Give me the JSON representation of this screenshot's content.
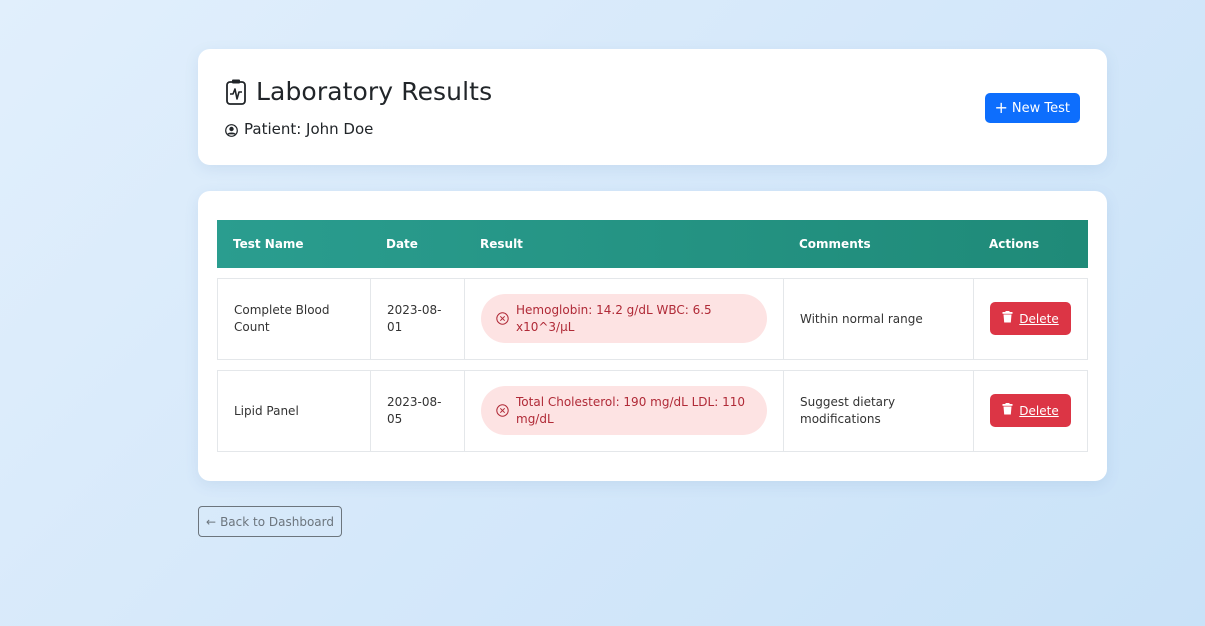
{
  "header": {
    "title": "Laboratory Results",
    "patient_label": "Patient: John Doe",
    "new_test_label": "New Test",
    "title_icon": "clipboard-pulse-icon",
    "patient_icon": "person-circle-icon"
  },
  "table": {
    "columns": [
      "Test Name",
      "Date",
      "Result",
      "Comments",
      "Actions"
    ],
    "rows": [
      {
        "test_name": "Complete Blood Count",
        "date": "2023-08-01",
        "result": "Hemoglobin: 14.2 g/dL WBC: 6.5 x10^3/µL",
        "comments": "Within normal range",
        "action": "Delete"
      },
      {
        "test_name": "Lipid Panel",
        "date": "2023-08-05",
        "result": "Total Cholesterol: 190 mg/dL LDL: 110 mg/dL",
        "comments": "Suggest dietary modifications",
        "action": "Delete"
      }
    ]
  },
  "footer": {
    "back_label": "Back to Dashboard",
    "back_arrow": "←"
  },
  "colors": {
    "primary": "#0d6efd",
    "header_teal": "#2a9d8f",
    "danger": "#dc3545",
    "result_bg": "#fde3e3",
    "result_text": "#b02a37"
  }
}
